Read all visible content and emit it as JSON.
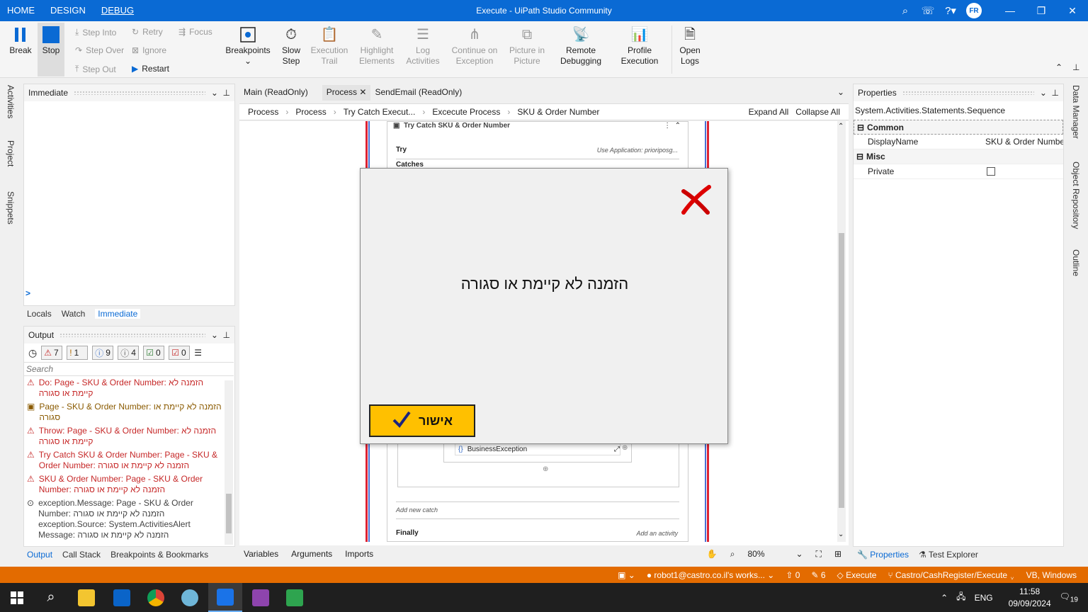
{
  "titlebar": {
    "menu": [
      "HOME",
      "DESIGN",
      "DEBUG"
    ],
    "active": "DEBUG",
    "title": "Execute - UiPath Studio Community",
    "avatar": "FR"
  },
  "ribbon": {
    "break": "Break",
    "stop": "Stop",
    "step_into": "Step Into",
    "step_over": "Step Over",
    "step_out": "Step Out",
    "retry": "Retry",
    "ignore": "Ignore",
    "restart": "Restart",
    "focus": "Focus",
    "breakpoints": "Breakpoints",
    "slow_step": "Slow Step",
    "execution_trail": "Execution Trail",
    "highlight_elements": "Highlight Elements",
    "log_activities": "Log Activities",
    "continue_on_exception": "Continue on Exception",
    "picture_in_picture": "Picture in Picture",
    "remote_debugging": "Remote Debugging",
    "profile_execution": "Profile Execution",
    "open_logs": "Open Logs"
  },
  "left_strip": [
    "Activities",
    "Project",
    "Snippets"
  ],
  "immediate": {
    "title": "Immediate",
    "prompt": ">",
    "tabs": [
      "Locals",
      "Watch",
      "Immediate"
    ],
    "active_tab": "Immediate"
  },
  "output": {
    "title": "Output",
    "filters": [
      {
        "icon": "warning-icon",
        "count": "7",
        "color": "#c62828"
      },
      {
        "icon": "warn-box-icon",
        "count": "1",
        "color": "#b36b00"
      },
      {
        "icon": "info-icon",
        "count": "9",
        "color": "#3a6fc9"
      },
      {
        "icon": "trace-icon",
        "count": "4",
        "color": "#555"
      },
      {
        "icon": "check-icon",
        "count": "0",
        "color": "#2e7d32"
      },
      {
        "icon": "fatal-icon",
        "count": "0",
        "color": "#c62828"
      }
    ],
    "search_placeholder": "Search",
    "items": [
      {
        "kind": "error",
        "text": "Do: Page - SKU & Order Number:  הזמנה לא קיימת או סגורה"
      },
      {
        "kind": "warn",
        "text": "Page - SKU & Order Number:  הזמנה לא קיימת או סגורה"
      },
      {
        "kind": "error",
        "text": "Throw: Page - SKU & Order Number:  הזמנה לא קיימת או סגורה"
      },
      {
        "kind": "error",
        "text": "Try Catch SKU & Order Number: Page - SKU & Order Number: הזמנה לא קיימת או סגורה"
      },
      {
        "kind": "error",
        "text": "SKU & Order Number: Page - SKU & Order Number: הזמנה לא קיימת או סגורה"
      },
      {
        "kind": "trace",
        "text": "exception.Message: Page - SKU & Order Number: הזמנה לא קיימת או סגורה exception.Source: System.ActivitiesAlert Message: הזמנה לא קיימת או סגורה"
      }
    ],
    "tabs": [
      "Output",
      "Call Stack",
      "Breakpoints & Bookmarks"
    ],
    "active_tab": "Output"
  },
  "doc_tabs": [
    "Main (ReadOnly)",
    "Process",
    "SendEmail (ReadOnly)"
  ],
  "active_doc": "Process",
  "breadcrumb": [
    "Process",
    "Process",
    "Try Catch Execut...",
    "Excecute Process",
    "SKU & Order Number"
  ],
  "expand_all": "Expand All",
  "collapse_all": "Collapse All",
  "designer": {
    "activity_title": "Try Catch SKU & Order Number",
    "try": "Try",
    "use_app": "Use Application: prioriposg...",
    "catches": "Catches",
    "exception": "BusinessException",
    "add_new_catch": "Add new catch",
    "finally": "Finally",
    "add_activity": "Add an activity"
  },
  "dialog": {
    "message": "הזמנה לא קיימת או סגורה",
    "ok": "אישור"
  },
  "designer_bottom": {
    "tabs": [
      "Variables",
      "Arguments",
      "Imports"
    ],
    "zoom": "80%"
  },
  "properties": {
    "title": "Properties",
    "type": "System.Activities.Statements.Sequence",
    "sections": [
      {
        "name": "Common",
        "rows": [
          {
            "key": "DisplayName",
            "value": "SKU & Order Number"
          }
        ]
      },
      {
        "name": "Misc",
        "rows": [
          {
            "key": "Private",
            "value": ""
          }
        ]
      }
    ],
    "tabs": [
      "Properties",
      "Test Explorer"
    ]
  },
  "right_strip": [
    "Data Manager",
    "Object Repository",
    "Outline"
  ],
  "statusbar": {
    "user": "robot1@castro.co.il's works...",
    "up": "0",
    "edits": "6",
    "project": "Execute",
    "branch": "Castro/CashRegister/Execute",
    "lang": "VB, Windows"
  },
  "taskbar": {
    "lang": "ENG",
    "time": "11:58",
    "date": "09/09/2024",
    "notif": "19"
  }
}
